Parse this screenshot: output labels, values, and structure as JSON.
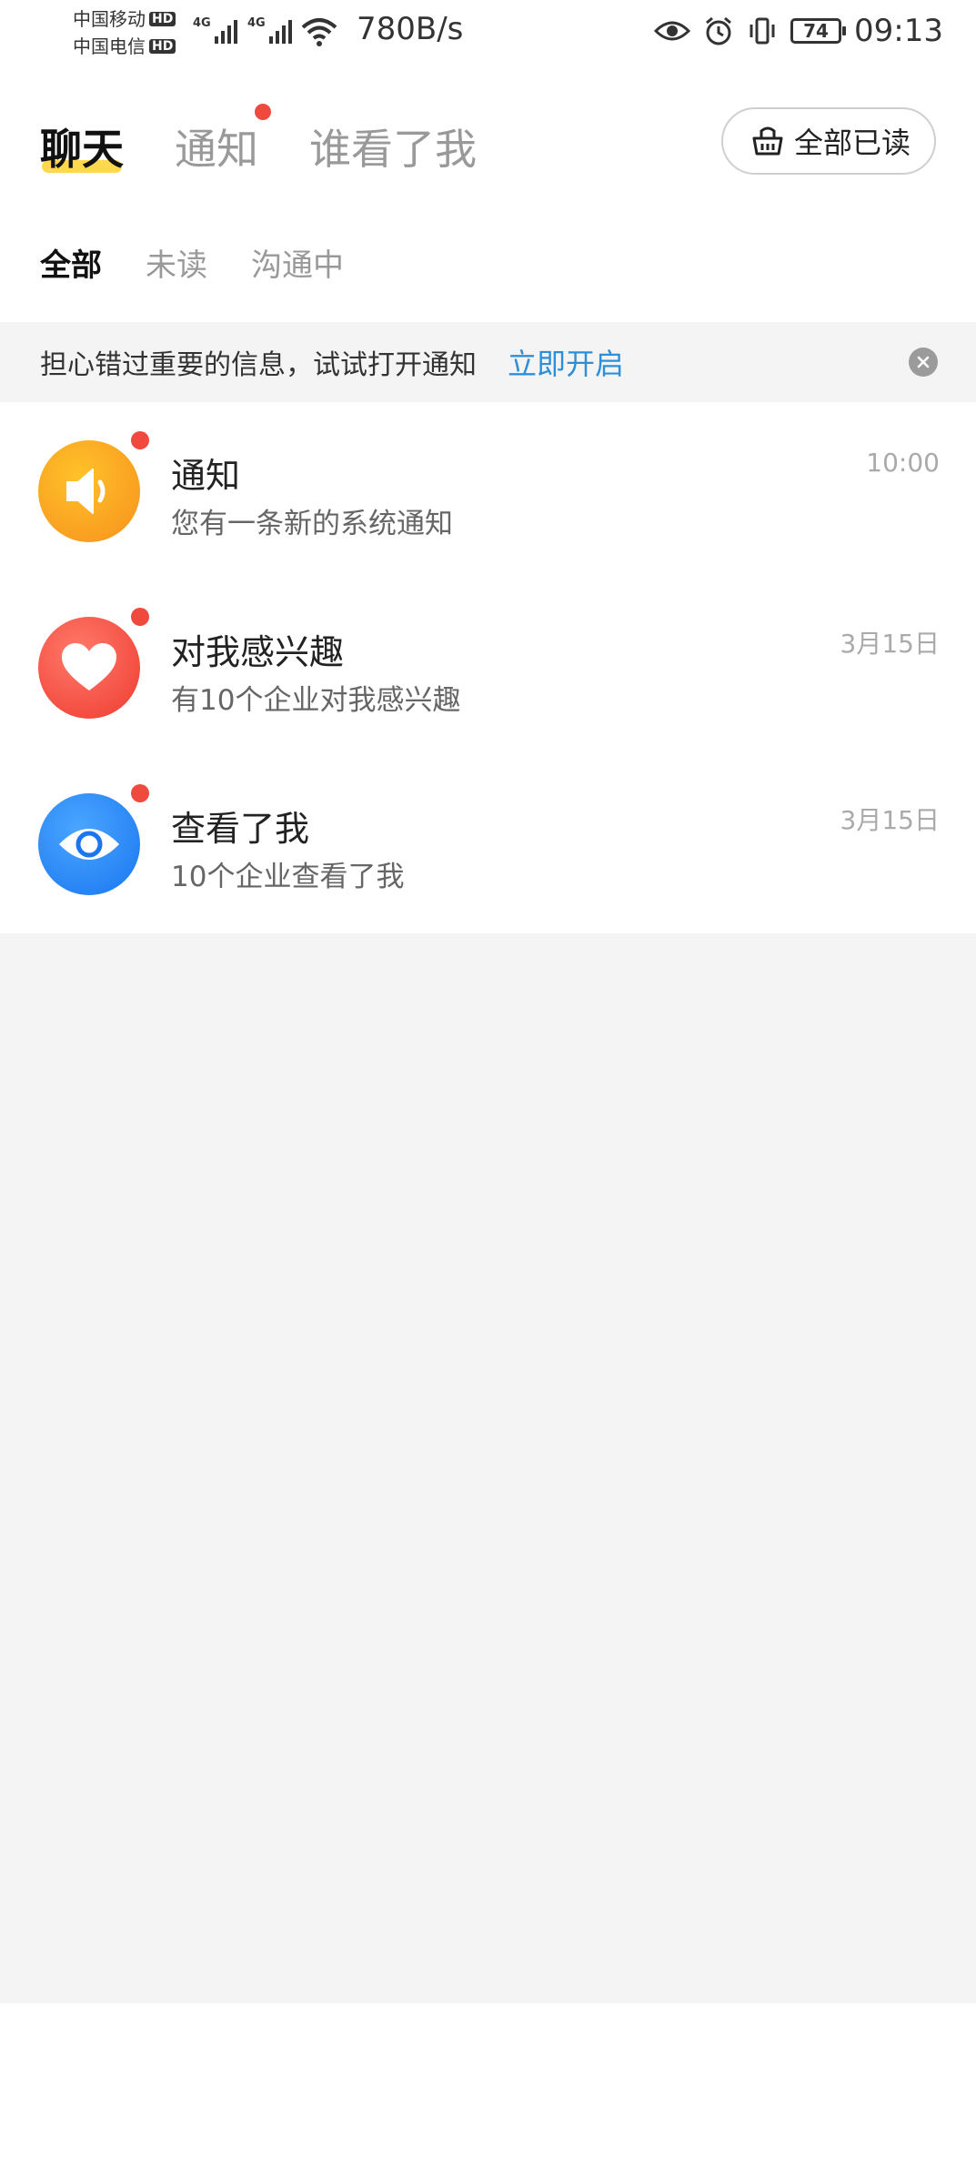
{
  "status_bar": {
    "carrier1": "中国移动",
    "carrier2": "中国电信",
    "hd_label": "HD",
    "net_type": "4G",
    "speed": "780B/s",
    "battery": "74",
    "time": "09:13"
  },
  "header": {
    "tabs": [
      {
        "label": "聊天",
        "active": true
      },
      {
        "label": "通知",
        "active": false,
        "has_dot": true
      },
      {
        "label": "谁看了我",
        "active": false
      }
    ],
    "mark_all_read": "全部已读"
  },
  "sub_tabs": [
    {
      "label": "全部",
      "active": true
    },
    {
      "label": "未读",
      "active": false
    },
    {
      "label": "沟通中",
      "active": false
    }
  ],
  "banner": {
    "text": "担心错过重要的信息，试试打开通知",
    "link": "立即开启"
  },
  "messages": [
    {
      "title": "通知",
      "subtitle": "您有一条新的系统通知",
      "time": "10:00",
      "icon": "speaker-icon",
      "color": "#f7a21e"
    },
    {
      "title": "对我感兴趣",
      "subtitle": "有10个企业对我感兴趣",
      "time": "3月15日",
      "icon": "heart-icon",
      "color": "#ee3b2f"
    },
    {
      "title": "查看了我",
      "subtitle": "10个企业查看了我",
      "time": "3月15日",
      "icon": "eye-icon",
      "color": "#1976f0"
    }
  ],
  "colors": {
    "accent_yellow": "#ffd84d",
    "link_blue": "#2e8fd8",
    "badge_red": "#f04a3e"
  }
}
